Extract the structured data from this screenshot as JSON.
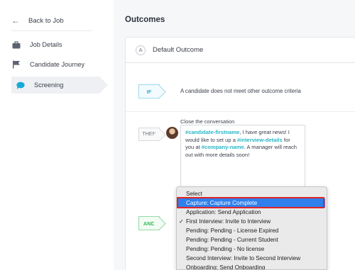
{
  "sidebar": {
    "back_label": "Back to Job",
    "items": [
      {
        "label": "Job Details",
        "icon": "briefcase-icon"
      },
      {
        "label": "Candidate Journey",
        "icon": "flag-icon"
      },
      {
        "label": "Screening",
        "icon": "chat-bubble-icon",
        "active": true
      }
    ]
  },
  "main": {
    "title": "Outcomes",
    "outcome": {
      "badge": "A",
      "name": "Default Outcome"
    },
    "if_rule": {
      "tag": "IF",
      "text": "A candidate does not meet other outcome criteria"
    },
    "then_rule": {
      "tag": "THEN",
      "action_label": "Close the conversation",
      "message": {
        "token_firstname": "#candidate-firstname",
        "part1": ", I have great news! I would like to set up a ",
        "token_interview": "#interview-details",
        "part2": " for you at ",
        "token_company": "#company-name",
        "part3": ". A manager will reach out with more details soon!"
      }
    },
    "and_rule": {
      "tag": "AND"
    }
  },
  "dropdown": {
    "options": [
      {
        "label": "Select",
        "selected": false,
        "highlighted": false
      },
      {
        "label": "Capture: Capture Complete",
        "selected": false,
        "highlighted": true
      },
      {
        "label": "Application: Send Application",
        "selected": false,
        "highlighted": false
      },
      {
        "label": "First Interview: Invite to Interview",
        "selected": true,
        "highlighted": false
      },
      {
        "label": "Pending: Pending - License Expired",
        "selected": false,
        "highlighted": false
      },
      {
        "label": "Pending: Pending - Current Student",
        "selected": false,
        "highlighted": false
      },
      {
        "label": "Pending: Pending - No license",
        "selected": false,
        "highlighted": false
      },
      {
        "label": "Second Interview: Invite to Second Interview",
        "selected": false,
        "highlighted": false
      },
      {
        "label": "Onboarding: Send Onboarding",
        "selected": false,
        "highlighted": false
      }
    ],
    "check_glyph": "✓"
  },
  "colors": {
    "accent_blue": "#2f80ed",
    "token_teal": "#26b7c8",
    "if_blue": "#3aaad4",
    "and_green": "#3ab85a",
    "highlight_frame": "#e02424"
  }
}
